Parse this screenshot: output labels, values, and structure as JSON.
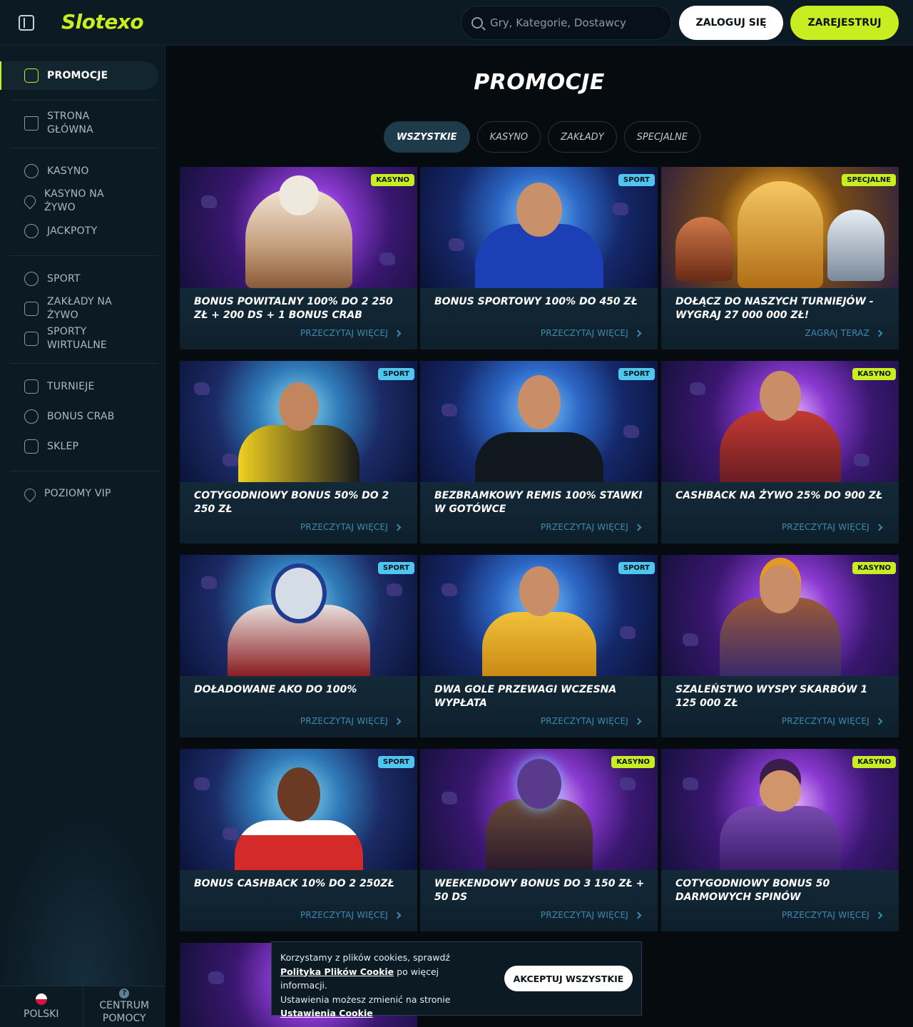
{
  "header": {
    "logo_text": "Slotexo",
    "search_placeholder": "Gry, Kategorie, Dostawcy",
    "login_label": "ZALOGUJ SIĘ",
    "register_label": "ZAREJESTRUJ",
    "accent_color": "#c8ee22"
  },
  "sidebar": {
    "items": [
      {
        "label": "PROMOCJE",
        "icon": "gift-icon",
        "active": true
      },
      {
        "label": "STRONA GŁÓWNA",
        "icon": "home-icon"
      },
      {
        "label": "KASYNO",
        "icon": "chip-icon"
      },
      {
        "label": "KASYNO NA ŻYWO",
        "icon": "spade-icon"
      },
      {
        "label": "JACKPOTY",
        "icon": "seven-icon"
      },
      {
        "label": "SPORT",
        "icon": "soccer-ball-icon"
      },
      {
        "label": "ZAKŁADY NA ŻYWO",
        "icon": "play-icon"
      },
      {
        "label": "SPORTY WIRTUALNE",
        "icon": "gamepad-icon"
      },
      {
        "label": "TURNIEJE",
        "icon": "trophy-icon"
      },
      {
        "label": "BONUS CRAB",
        "icon": "crab-icon"
      },
      {
        "label": "SKLEP",
        "icon": "shop-icon"
      },
      {
        "label": "POZIOMY VIP",
        "icon": "diamond-icon"
      }
    ],
    "footer": {
      "language": "POLSKI",
      "help": "CENTRUM POMOCY"
    }
  },
  "main": {
    "title": "PROMOCJE",
    "tabs": [
      {
        "label": "WSZYSTKIE",
        "active": true
      },
      {
        "label": "KASYNO"
      },
      {
        "label": "ZAKŁADY"
      },
      {
        "label": "SPECJALNE"
      }
    ],
    "cards": [
      {
        "title": "BONUS POWITALNY 100% DO 2 250 ZŁ + 200 DS + 1 BONUS CRAB",
        "link": "PRZECZYTAJ WIĘCEJ",
        "badge": "KASYNO",
        "badge_type": "kasyno"
      },
      {
        "title": "BONUS SPORTOWY 100% DO 450 ZŁ",
        "link": "PRZECZYTAJ WIĘCEJ",
        "badge": "SPORT",
        "badge_type": "sport"
      },
      {
        "title": "DOŁĄCZ DO NASZYCH TURNIEJÓW - WYGRAJ 27 000 000 ZŁ!",
        "link": "ZAGRAJ TERAZ",
        "badge": "SPECJALNE",
        "badge_type": "specjalne"
      },
      {
        "title": "COTYGODNIOWY BONUS 50% DO 2 250 ZŁ",
        "link": "PRZECZYTAJ WIĘCEJ",
        "badge": "SPORT",
        "badge_type": "sport"
      },
      {
        "title": "BEZBRAMKOWY REMIS 100% STAWKI W GOTÓWCE",
        "link": "PRZECZYTAJ WIĘCEJ",
        "badge": "SPORT",
        "badge_type": "sport"
      },
      {
        "title": "CASHBACK NA ŻYWO 25% DO 900 ZŁ",
        "link": "PRZECZYTAJ WIĘCEJ",
        "badge": "KASYNO",
        "badge_type": "kasyno"
      },
      {
        "title": "DOŁADOWANE AKO DO 100%",
        "link": "PRZECZYTAJ WIĘCEJ",
        "badge": "SPORT",
        "badge_type": "sport"
      },
      {
        "title": "DWA GOLE PRZEWAGI WCZESNA WYPŁATA",
        "link": "PRZECZYTAJ WIĘCEJ",
        "badge": "SPORT",
        "badge_type": "sport"
      },
      {
        "title": "SZALEŃSTWO WYSPY SKARBÓW 1 125 000 ZŁ",
        "link": "PRZECZYTAJ WIĘCEJ",
        "badge": "KASYNO",
        "badge_type": "kasyno"
      },
      {
        "title": "BONUS CASHBACK 10% DO 2 250ZŁ",
        "link": "PRZECZYTAJ WIĘCEJ",
        "badge": "SPORT",
        "badge_type": "sport"
      },
      {
        "title": "WEEKENDOWY BONUS DO 3 150 ZŁ + 50 DS",
        "link": "PRZECZYTAJ WIĘCEJ",
        "badge": "KASYNO",
        "badge_type": "kasyno"
      },
      {
        "title": "COTYGODNIOWY BONUS 50 DARMOWYCH SPINÓW",
        "link": "PRZECZYTAJ WIĘCEJ",
        "badge": "KASYNO",
        "badge_type": "kasyno"
      }
    ]
  },
  "cookie": {
    "line1": "Korzystamy z plików cookies, sprawdź",
    "policy_link": "Polityka Plików Cookie",
    "line2": " po więcej informacji.",
    "line3": "Ustawienia możesz zmienić na stronie",
    "settings_link": "Ustawienia Cookie",
    "accept_label": "AKCEPTUJ WSZYSTKIE"
  }
}
